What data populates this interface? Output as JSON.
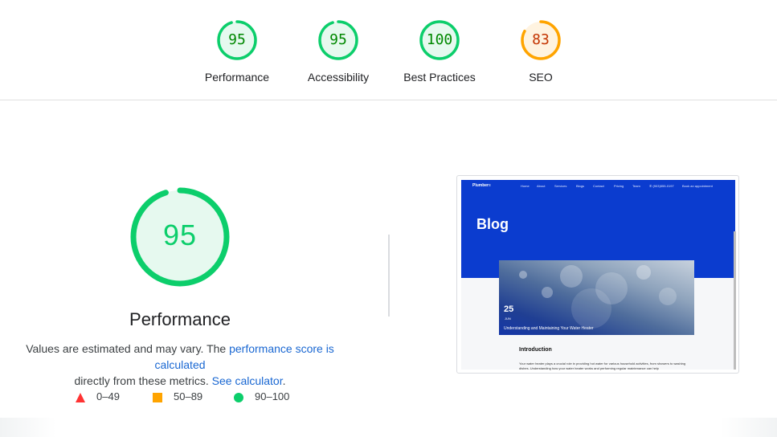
{
  "summary_gauges": [
    {
      "score": "95",
      "label": "Performance",
      "color": "#0cce6b",
      "fraction": 0.95
    },
    {
      "score": "95",
      "label": "Accessibility",
      "color": "#0cce6b",
      "fraction": 0.95
    },
    {
      "score": "100",
      "label": "Best Practices",
      "color": "#0cce6b",
      "fraction": 1.0
    },
    {
      "score": "83",
      "label": "SEO",
      "color": "#ffa400",
      "fraction": 0.83
    }
  ],
  "performance": {
    "score": "95",
    "fraction": 0.95,
    "title": "Performance",
    "desc_part1": "Values are estimated and may vary. The ",
    "link_score": "performance score is calculated",
    "desc_part2": "directly from these metrics. ",
    "link_calculator": "See calculator",
    "desc_end": "."
  },
  "legend": [
    {
      "shape": "triangle-icon",
      "range": "0–49",
      "color": "#ff3333"
    },
    {
      "shape": "square-icon",
      "range": "50–89",
      "color": "#ffa400"
    },
    {
      "shape": "circle-icon",
      "range": "90–100",
      "color": "#0cce6b"
    }
  ],
  "screenshot": {
    "logo": "Plumber≡",
    "nav": [
      "Home",
      "About",
      "Services",
      "Blogs",
      "Contact",
      "Pricing",
      "Team",
      "(903)555-0197",
      "Book an appointment"
    ],
    "blog_title": "Blog",
    "hero_day": "25",
    "hero_month": "JUN",
    "hero_caption": "Understanding and Maintaining Your Water Heater",
    "intro_heading": "Introduction",
    "intro_text": "Your water heater plays a crucial role in providing hot water for various household activities, from showers to washing dishes. Understanding how your water heater works and performing regular maintenance can help"
  }
}
